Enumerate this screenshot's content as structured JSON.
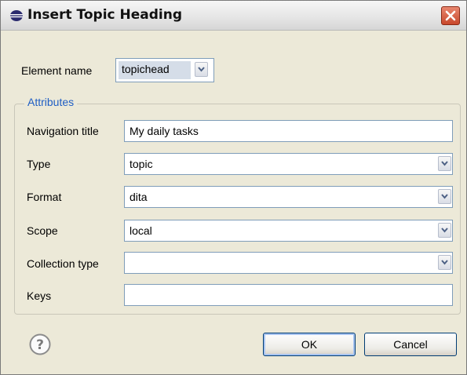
{
  "window": {
    "title": "Insert Topic Heading",
    "close_icon": "close-icon"
  },
  "element_name": {
    "label": "Element name",
    "value": "topichead"
  },
  "attributes": {
    "group_label": "Attributes",
    "navigation_title": {
      "label": "Navigation title",
      "value": "My daily tasks"
    },
    "type": {
      "label": "Type",
      "value": "topic"
    },
    "format": {
      "label": "Format",
      "value": "dita"
    },
    "scope": {
      "label": "Scope",
      "value": "local"
    },
    "collection_type": {
      "label": "Collection type",
      "value": ""
    },
    "keys": {
      "label": "Keys",
      "value": ""
    }
  },
  "buttons": {
    "ok": "OK",
    "cancel": "Cancel"
  },
  "colors": {
    "dialog_bg": "#ece9d8",
    "group_label": "#1f5ec4",
    "close_red": "#d45a3c"
  }
}
